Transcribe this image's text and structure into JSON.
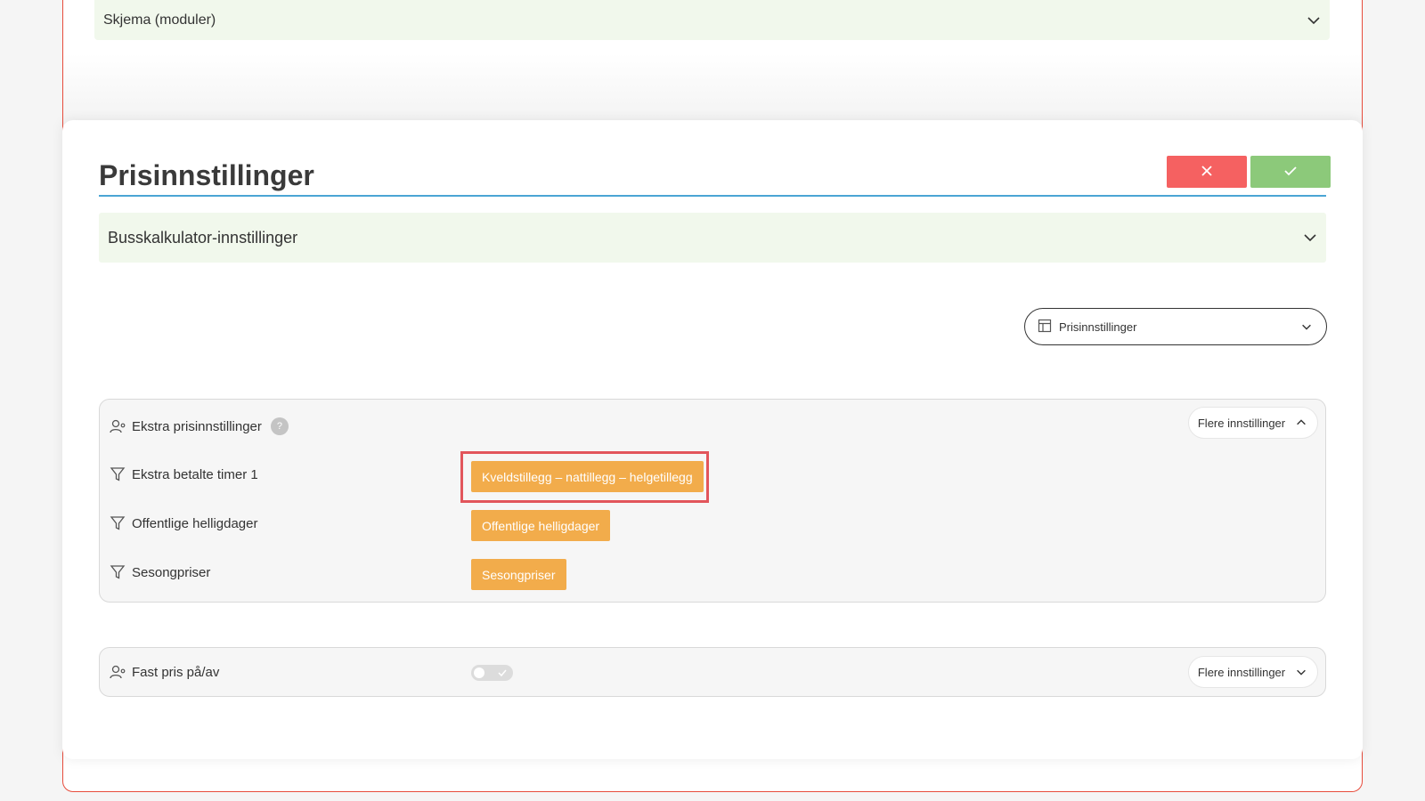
{
  "top_section": {
    "label": "Skjema (moduler)"
  },
  "modal": {
    "title": "Prisinnstillinger",
    "actions": {
      "cancel_icon": "close-icon",
      "confirm_icon": "check-icon"
    },
    "accordion": {
      "label": "Busskalkulator-innstillinger"
    },
    "view_select": {
      "value": "Prisinnstillinger",
      "icon": "table-icon"
    },
    "extra_panel": {
      "header_label": "Ekstra prisinnstillinger",
      "help": "?",
      "more_label": "Flere innstillinger",
      "rows": [
        {
          "label": "Ekstra betalte timer 1",
          "button": "Kveldstillegg – nattillegg – helgetillegg"
        },
        {
          "label": "Offentlige helligdager",
          "button": "Offentlige helligdager"
        },
        {
          "label": "Sesongpriser",
          "button": "Sesongpriser"
        }
      ]
    },
    "fixed_panel": {
      "label": "Fast pris på/av",
      "toggle_on": false,
      "more_label": "Flere innstillinger"
    }
  },
  "colors": {
    "accent_blue": "#4aa5d4",
    "cancel_red": "#f56161",
    "confirm_green": "#8cc97a",
    "orange": "#f2ac4b",
    "highlight_red": "#e2555b",
    "accordion_bg": "#f1f8ec"
  }
}
